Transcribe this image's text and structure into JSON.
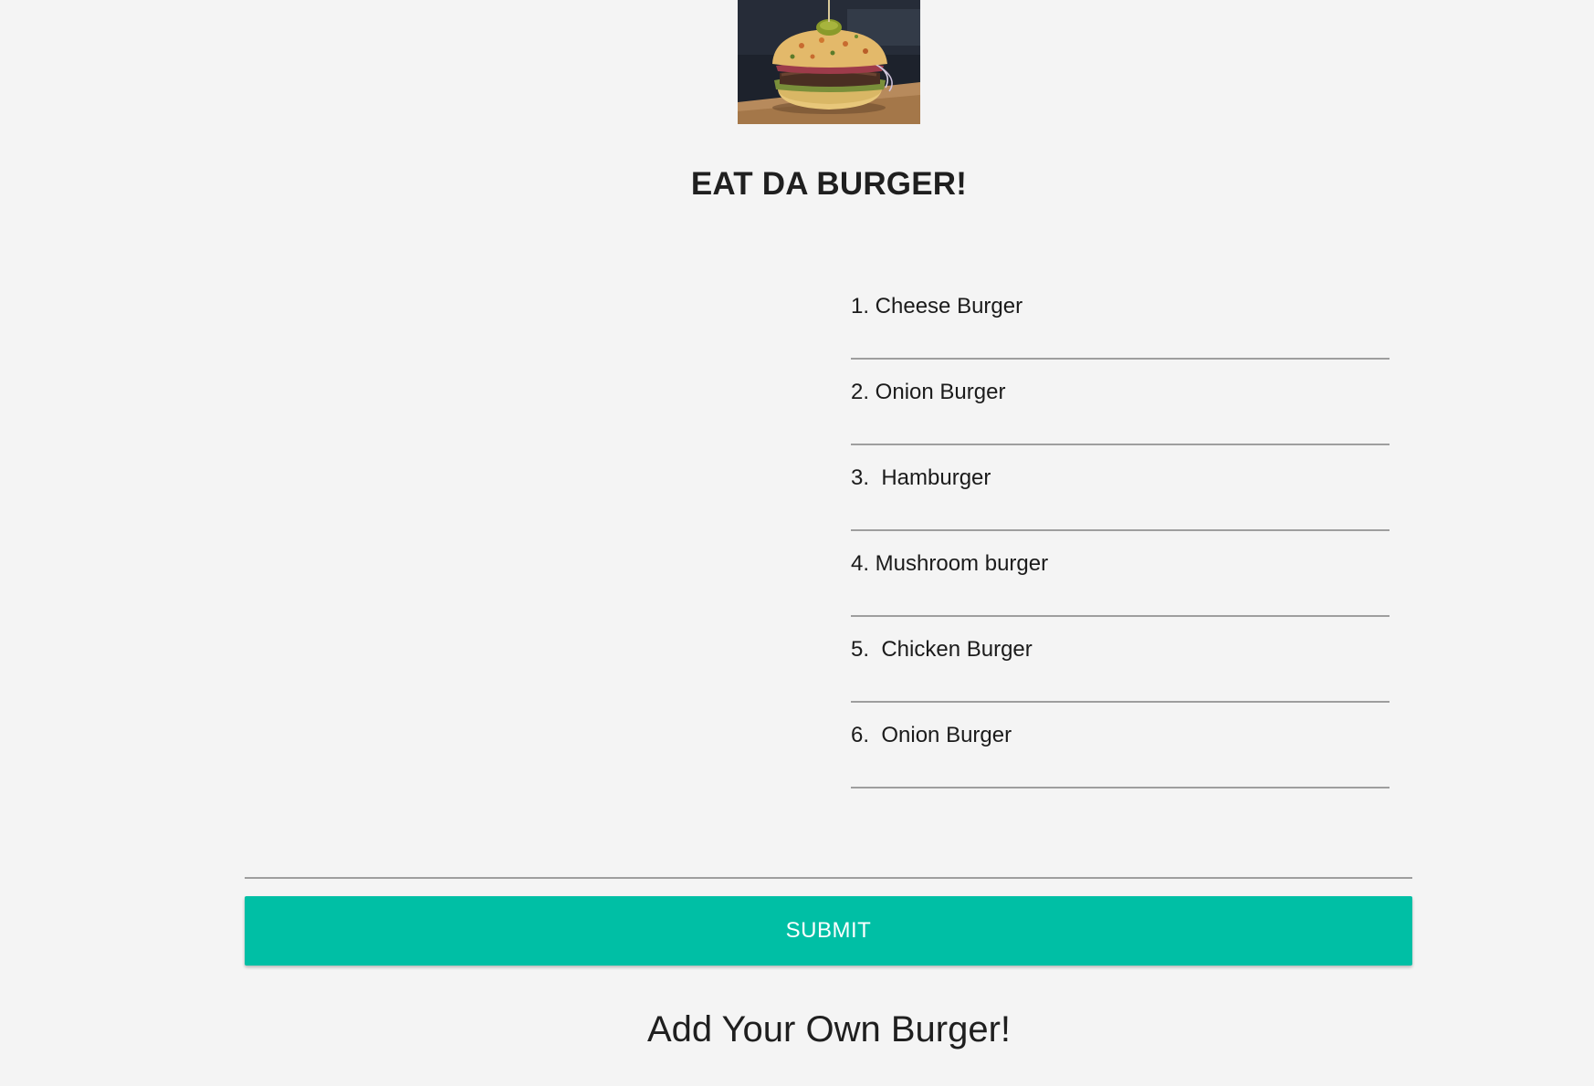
{
  "header": {
    "image_alt": "Burger photo",
    "title": "EAT DA BURGER!"
  },
  "burgers": [
    {
      "label": "1. Cheese Burger"
    },
    {
      "label": "2. Onion Burger"
    },
    {
      "label": "3.  Hamburger"
    },
    {
      "label": "4. Mushroom burger"
    },
    {
      "label": "5.  Chicken Burger"
    },
    {
      "label": "6.  Onion Burger"
    }
  ],
  "form": {
    "input_value": "",
    "submit_label": "SUBMIT"
  },
  "footer": {
    "add_heading": "Add Your Own Burger!"
  },
  "colors": {
    "background": "#f4f4f4",
    "submit_button": "#00bfa5",
    "divider": "#9e9e9e"
  }
}
